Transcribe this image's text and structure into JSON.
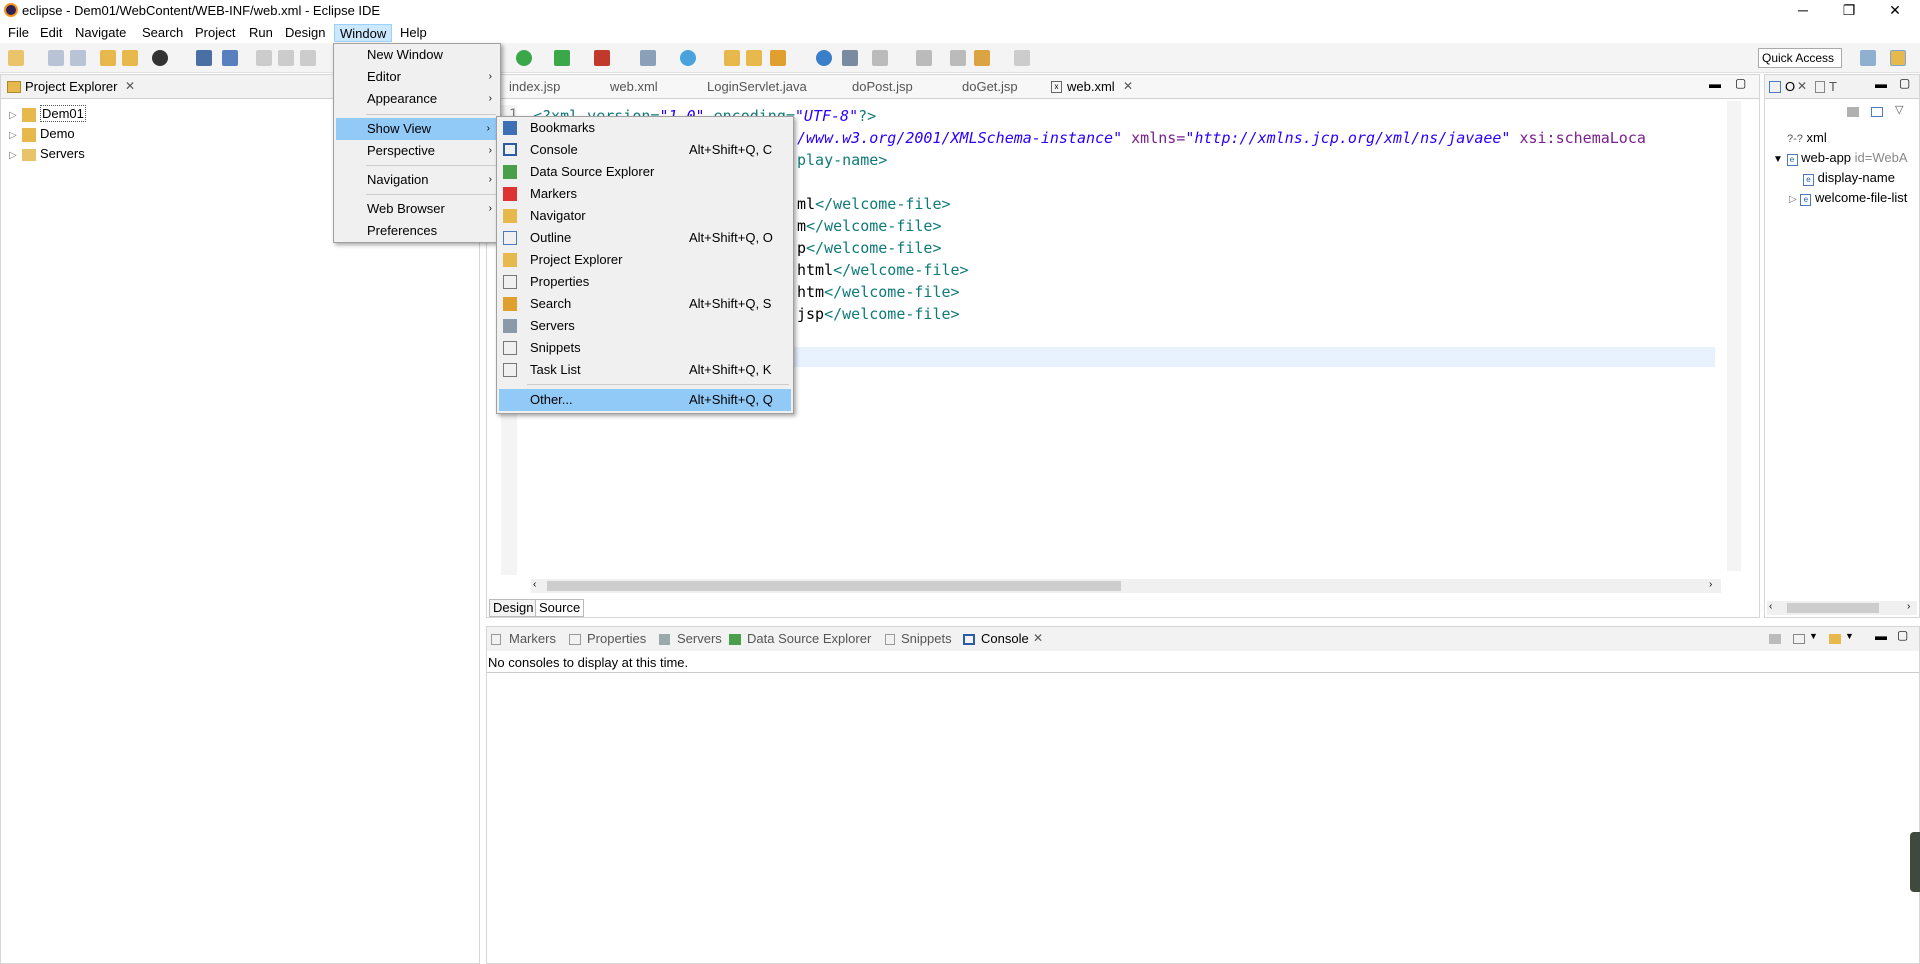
{
  "window": {
    "title": "eclipse - Dem01/WebContent/WEB-INF/web.xml - Eclipse IDE",
    "controls": [
      "─",
      "❐",
      "✕"
    ]
  },
  "menubar": [
    "File",
    "Edit",
    "Navigate",
    "Search",
    "Project",
    "Run",
    "Design",
    "Window",
    "Help"
  ],
  "toolbar": {
    "quick_access": "Quick Access"
  },
  "project_explorer": {
    "title": "Project Explorer",
    "items": [
      "Dem01",
      "Demo",
      "Servers"
    ]
  },
  "editor": {
    "tabs": [
      "index.jsp",
      "web.xml",
      "LoginServlet.java",
      "doPost.jsp",
      "doGet.jsp",
      "web.xml"
    ],
    "line_number": "1",
    "lines": {
      "l1_a": "<?xml version=",
      "l1_b": "\"1.0\"",
      "l1_c": " encoding=",
      "l1_d": "\"UTF-8\"",
      "l1_e": "?>",
      "l2_a": "/www.w3.org/2001/XMLSchema-instance\"",
      "l2_b": " xmlns=",
      "l2_c": "\"http://xmlns.jcp.org/xml/ns/javaee\"",
      "l2_d": " xsi:schemaLoca",
      "l3": "play-name>",
      "l5_a": "ml",
      "l5_b": "</welcome-file>",
      "l6_a": "m",
      "l6_b": "</welcome-file>",
      "l7_a": "p",
      "l7_b": "</welcome-file>",
      "l8_a": "html",
      "l8_b": "</welcome-file>",
      "l9_a": "htm",
      "l9_b": "</welcome-file>",
      "l10_a": "jsp",
      "l10_b": "</welcome-file>"
    },
    "bottom_tabs": [
      "Design",
      "Source"
    ]
  },
  "outline": {
    "tabs": [
      "O",
      "T"
    ],
    "items": [
      {
        "label": "xml",
        "extra": ""
      },
      {
        "label": "web-app",
        "extra": " id=WebA"
      },
      {
        "label": "display-name",
        "extra": ""
      },
      {
        "label": "welcome-file-list",
        "extra": ""
      }
    ]
  },
  "bottom_panel": {
    "tabs": [
      "Markers",
      "Properties",
      "Servers",
      "Data Source Explorer",
      "Snippets",
      "Console"
    ],
    "message": "No consoles to display at this time."
  },
  "window_menu": {
    "items": [
      "New Window",
      "Editor",
      "Appearance",
      "Show View",
      "Perspective",
      "Navigation",
      "Web Browser",
      "Preferences"
    ]
  },
  "show_view_menu": {
    "items": [
      {
        "label": "Bookmarks",
        "shortcut": ""
      },
      {
        "label": "Console",
        "shortcut": "Alt+Shift+Q, C"
      },
      {
        "label": "Data Source Explorer",
        "shortcut": ""
      },
      {
        "label": "Markers",
        "shortcut": ""
      },
      {
        "label": "Navigator",
        "shortcut": ""
      },
      {
        "label": "Outline",
        "shortcut": "Alt+Shift+Q, O"
      },
      {
        "label": "Project Explorer",
        "shortcut": ""
      },
      {
        "label": "Properties",
        "shortcut": ""
      },
      {
        "label": "Search",
        "shortcut": "Alt+Shift+Q, S"
      },
      {
        "label": "Servers",
        "shortcut": ""
      },
      {
        "label": "Snippets",
        "shortcut": ""
      },
      {
        "label": "Task List",
        "shortcut": "Alt+Shift+Q, K"
      },
      {
        "label": "Other...",
        "shortcut": "Alt+Shift+Q, Q"
      }
    ]
  },
  "colors": {
    "menu_highlight": "#91c9f7",
    "xml_tag": "#0f7a7a",
    "xml_attr": "#7a1f8f",
    "xml_value": "#2a00ff"
  }
}
